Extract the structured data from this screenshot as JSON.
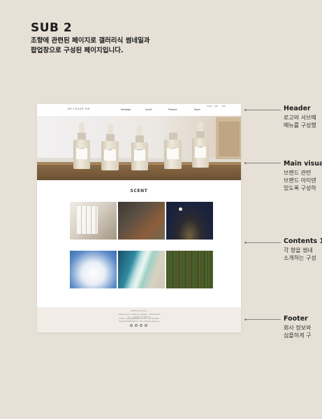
{
  "page": {
    "title": "SUB 2",
    "description": "조향에 관련된 페이지로 갤러리식 썸네일과\n팝업창으로 구성된 페이지입니다."
  },
  "mockup": {
    "logo": "RE:LEASE·ME",
    "nav": [
      "Heritage",
      "Scent",
      "Product",
      "Store"
    ],
    "util": [
      "LOGIN",
      "JOIN",
      "CART"
    ],
    "bottle_labels": [
      "SOLACE",
      "CALM",
      "TRANQUIL",
      "BLOOM",
      "SERENE"
    ],
    "section_title": "SCENT",
    "gallery": [
      {
        "name": "window-curtain"
      },
      {
        "name": "sofa-interior"
      },
      {
        "name": "night-moon"
      },
      {
        "name": "sky-clouds"
      },
      {
        "name": "ocean-shore"
      },
      {
        "name": "forest-wood"
      }
    ],
    "footer": {
      "lines": [
        "HOME   Privacy policy",
        "고객센터   대표이사 : 00000   사업자등록번호 : 000-00-00000",
        "주소 : 서울특별시 00구 00로 00",
        "E-MAIL : release@release.com   TEL : 02-000-0000",
        "Copyright©RELEASE CO., LTD. All Rights Reserved."
      ],
      "sns": [
        "instagram-icon",
        "facebook-icon",
        "youtube-icon",
        "blog-icon"
      ]
    }
  },
  "annotations": [
    {
      "title": "Header",
      "desc": "로고와 서브메\n메뉴를 구성했"
    },
    {
      "title": "Main visual",
      "desc": "브랜드 관련\n브랜드 아이덴\n있도록 구성하"
    },
    {
      "title": "Contents 1",
      "desc": "각 향을 썸네\n소개하는 구성"
    },
    {
      "title": "Footer",
      "desc": "회사 정보와\n심플하게 구"
    }
  ]
}
